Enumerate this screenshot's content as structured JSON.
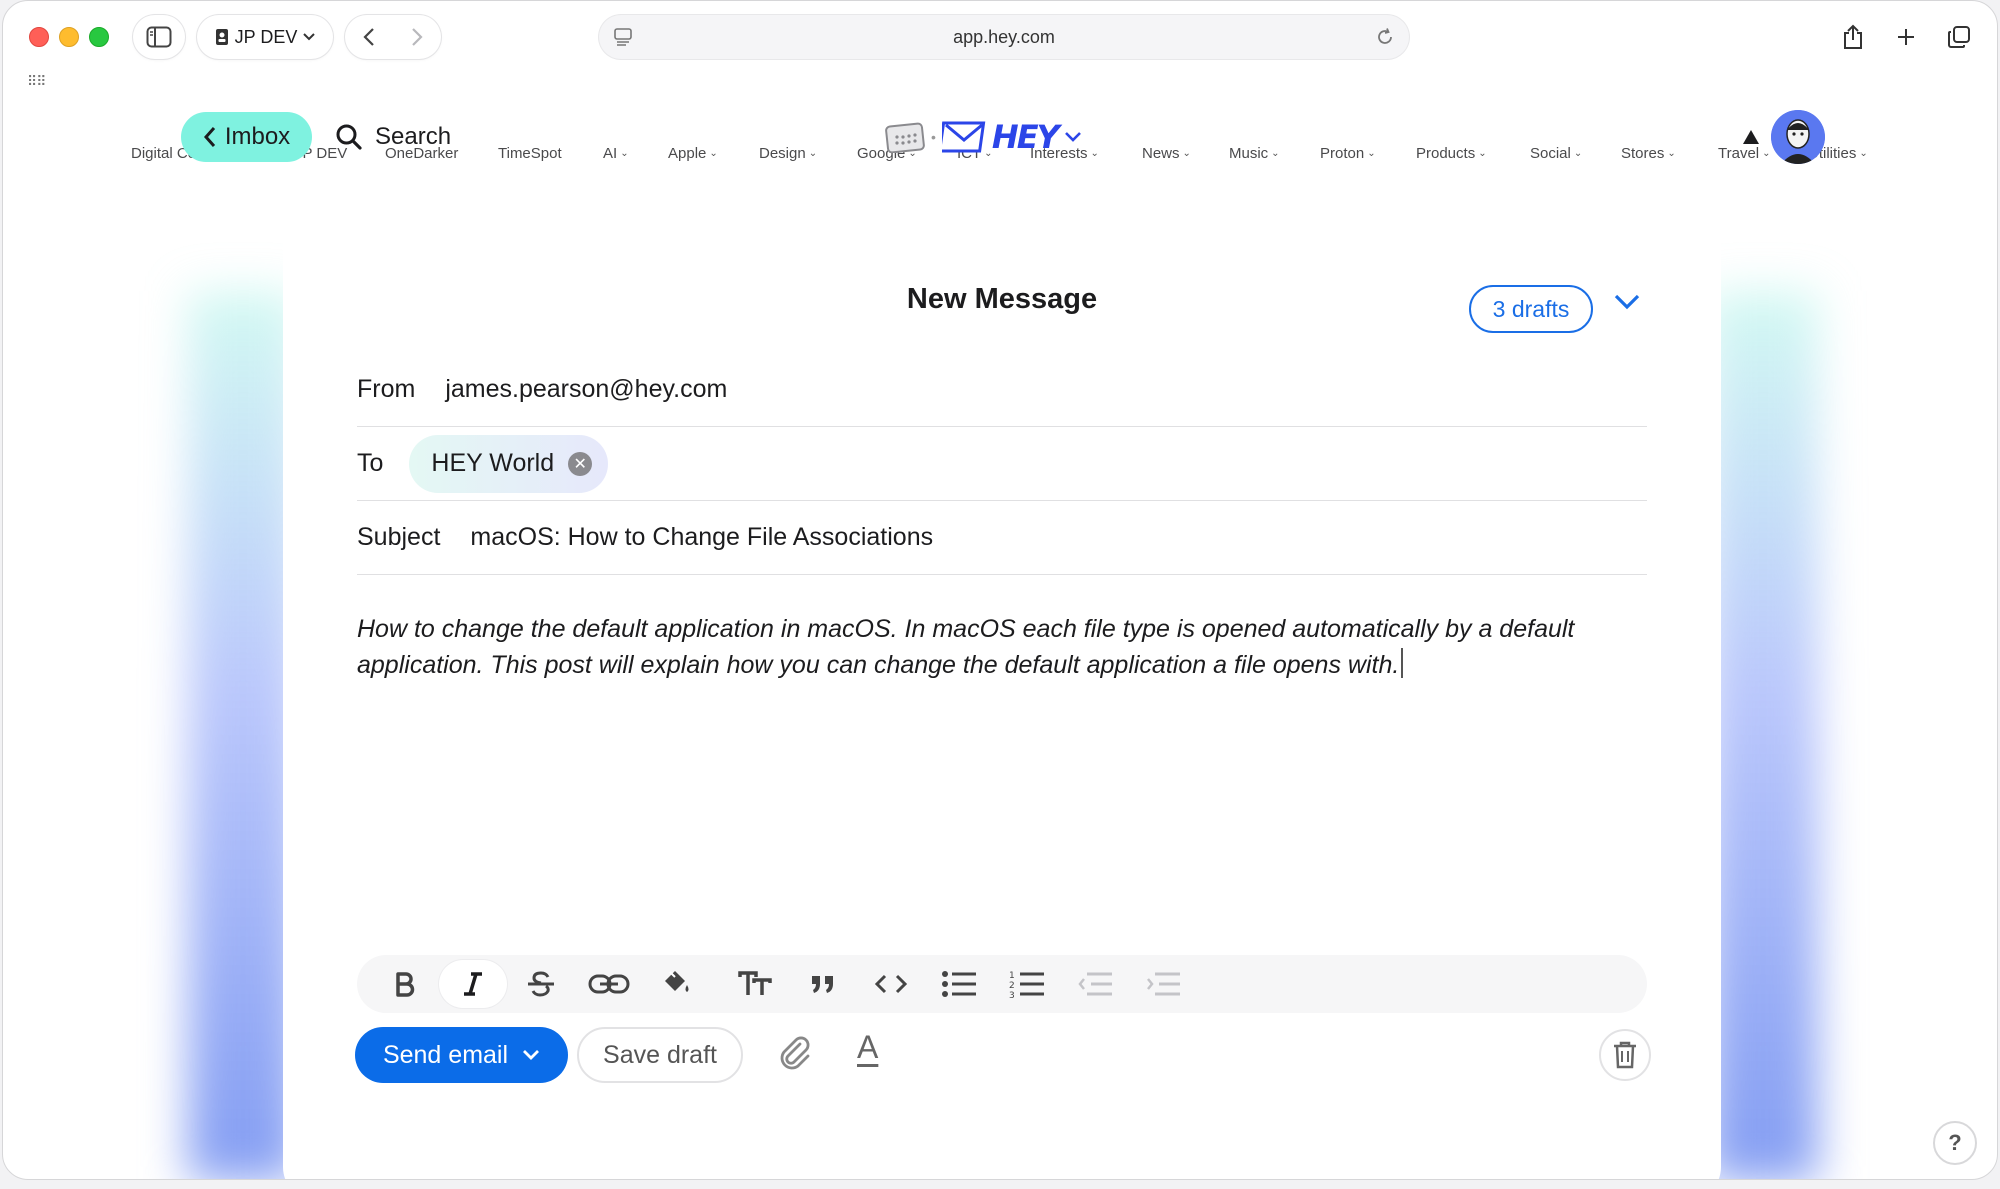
{
  "browser": {
    "profile_label": "JP DEV",
    "url": "app.hey.com",
    "favorites": [
      {
        "label": "Digital Courseway",
        "has_menu": false
      },
      {
        "label": "JP DEV",
        "has_menu": false
      },
      {
        "label": "OneDarker",
        "has_menu": false
      },
      {
        "label": "TimeSpot",
        "has_menu": false
      },
      {
        "label": "AI",
        "has_menu": true
      },
      {
        "label": "Apple",
        "has_menu": true
      },
      {
        "label": "Design",
        "has_menu": true
      },
      {
        "label": "Google",
        "has_menu": true
      },
      {
        "label": "ICT",
        "has_menu": true
      },
      {
        "label": "Interests",
        "has_menu": true
      },
      {
        "label": "News",
        "has_menu": true
      },
      {
        "label": "Music",
        "has_menu": true
      },
      {
        "label": "Proton",
        "has_menu": true
      },
      {
        "label": "Products",
        "has_menu": true
      },
      {
        "label": "Social",
        "has_menu": true
      },
      {
        "label": "Stores",
        "has_menu": true
      },
      {
        "label": "Travel",
        "has_menu": true
      },
      {
        "label": "Utilities",
        "has_menu": true
      }
    ]
  },
  "header": {
    "imbox_label": "Imbox",
    "search_label": "Search",
    "logo_text": "HEY"
  },
  "composer": {
    "title": "New Message",
    "drafts_label": "3 drafts",
    "from_label": "From",
    "from_value": "james.pearson@hey.com",
    "to_label": "To",
    "to_recipient": "HEY World",
    "subject_label": "Subject",
    "subject_value": "macOS: How to Change File Associations",
    "body": "How to change the default application in macOS. In macOS each file type is opened automatically by a default application. This post will explain how you can change the default application a file opens with.",
    "send_label": "Send email",
    "save_label": "Save draft",
    "font_color_glyph": "A"
  },
  "help_label": "?",
  "colors": {
    "imbox_accent": "#7ff2e0",
    "primary_blue": "#0b6ce8",
    "hey_logo_blue": "#2b45e8"
  }
}
